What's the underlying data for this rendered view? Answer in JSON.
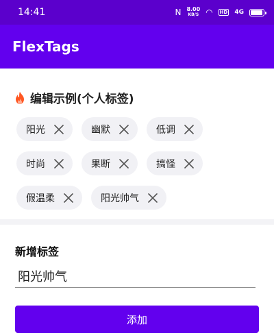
{
  "status_bar": {
    "time": "14:41",
    "nfc_glyph": "N",
    "net_speed_value": "8.00",
    "net_speed_unit": "KB/S",
    "wifi_glyph": "◠",
    "hd_badge": "HD",
    "signal_label": "4G",
    "battery_level": 0.95
  },
  "app_bar": {
    "title": "FlexTags"
  },
  "tag_section": {
    "title": "编辑示例(个人标签)",
    "icon": "fire-icon",
    "accent_color": "#ff5722",
    "tags": [
      {
        "label": "阳光"
      },
      {
        "label": "幽默"
      },
      {
        "label": "低调"
      },
      {
        "label": "时尚"
      },
      {
        "label": "果断"
      },
      {
        "label": "搞怪"
      },
      {
        "label": "假温柔"
      },
      {
        "label": "阳光帅气"
      }
    ]
  },
  "new_tag_form": {
    "label": "新增标签",
    "input_value": "阳光帅气",
    "add_button_label": "添加"
  },
  "colors": {
    "primary": "#6200ee",
    "status_bar": "#5b00cc",
    "chip_bg": "#f1f1f5"
  }
}
